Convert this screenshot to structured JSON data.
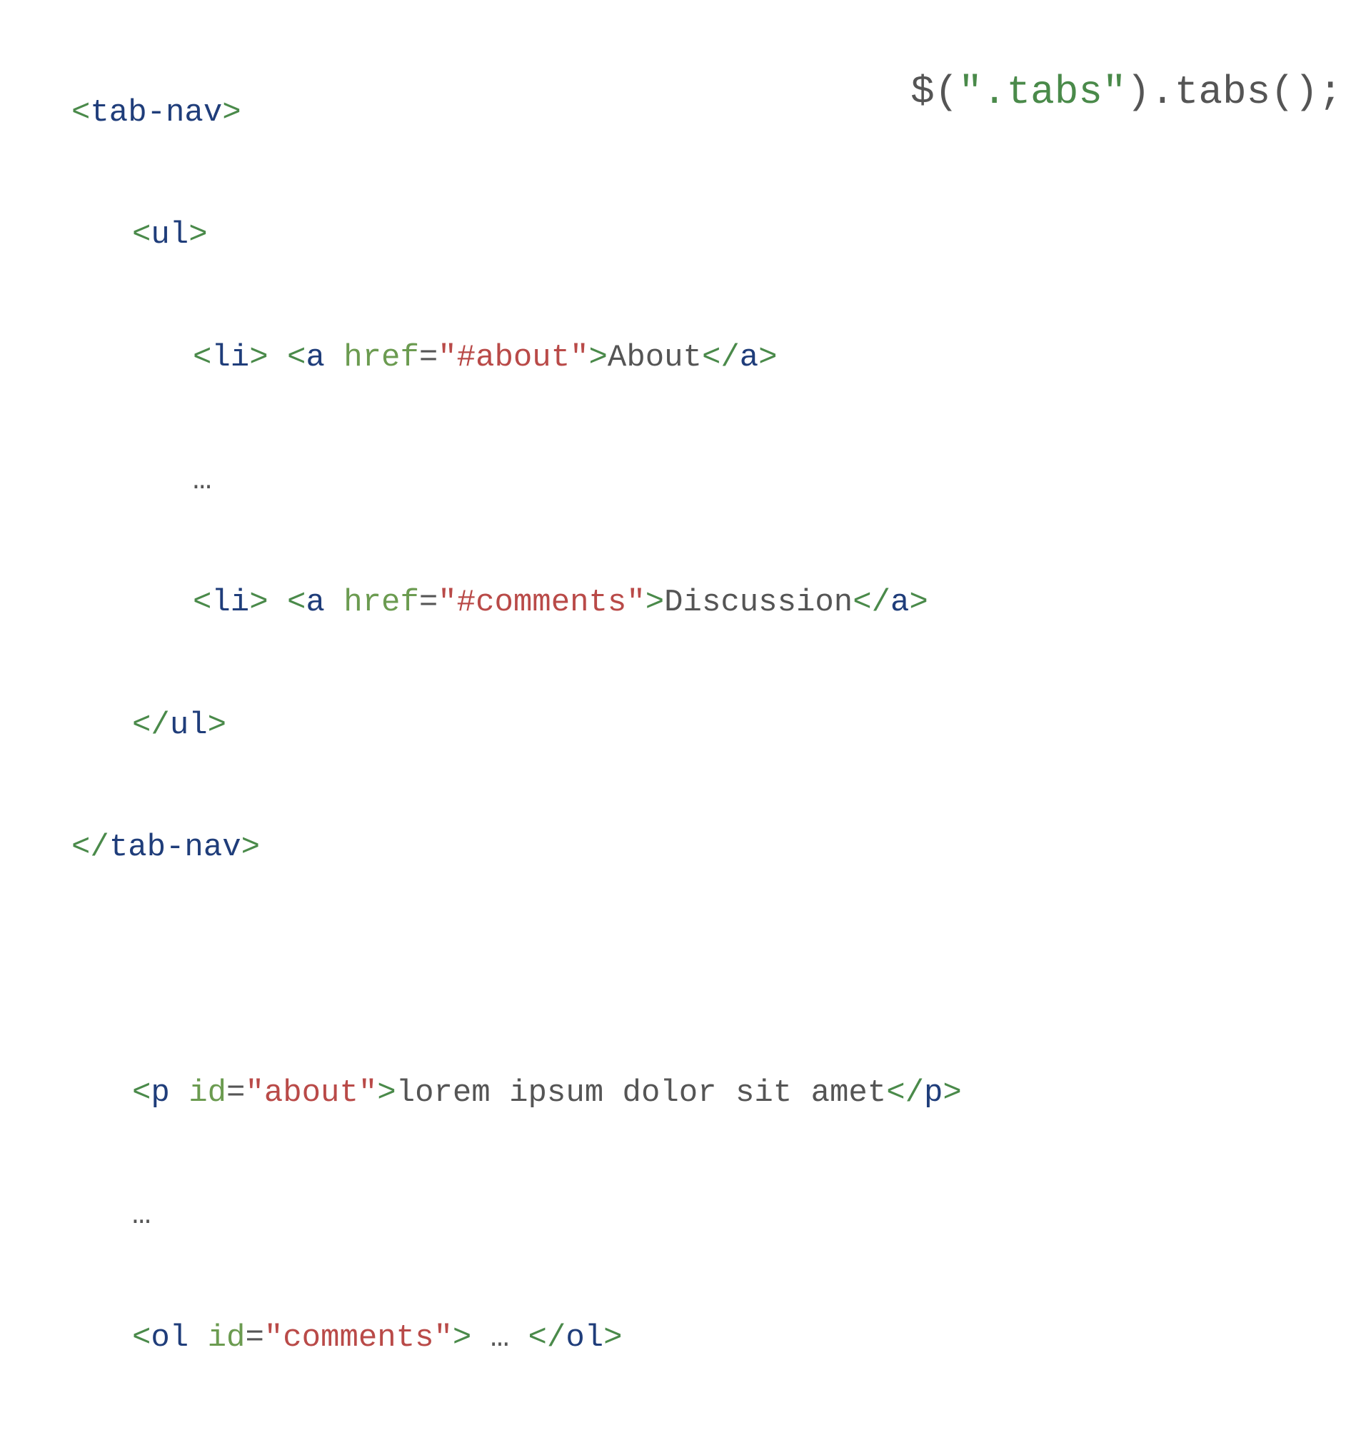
{
  "code": {
    "line1": {
      "open_bracket": "<",
      "tag": "tab-nav",
      "close_bracket": ">"
    },
    "line2": {
      "open_bracket": "<",
      "tag": "ul",
      "close_bracket": ">"
    },
    "line3": {
      "li_open_bracket": "<",
      "li_tag": "li",
      "li_close_bracket": ">",
      "space": " ",
      "a_open_bracket": "<",
      "a_tag": "a",
      "attr_space": " ",
      "attr_name": "href",
      "eq": "=",
      "attr_value": "\"#about\"",
      "a_close_bracket": ">",
      "content": "About",
      "a_end_open": "</",
      "a_end_tag": "a",
      "a_end_close": ">"
    },
    "line4": {
      "ellipsis": "…"
    },
    "line5": {
      "li_open_bracket": "<",
      "li_tag": "li",
      "li_close_bracket": ">",
      "space": " ",
      "a_open_bracket": "<",
      "a_tag": "a",
      "attr_space": " ",
      "attr_name": "href",
      "eq": "=",
      "attr_value": "\"#comments\"",
      "a_close_bracket": ">",
      "content": "Discussion",
      "a_end_open": "</",
      "a_end_tag": "a",
      "a_end_close": ">"
    },
    "line6": {
      "open_bracket": "</",
      "tag": "ul",
      "close_bracket": ">"
    },
    "line7": {
      "open_bracket": "</",
      "tag": "tab-nav",
      "close_bracket": ">"
    },
    "line9": {
      "open_bracket": "<",
      "tag": "p",
      "attr_space": " ",
      "attr_name": "id",
      "eq": "=",
      "attr_value": "\"about\"",
      "close_bracket": ">",
      "content": "lorem ipsum dolor sit amet",
      "end_open": "</",
      "end_tag": "p",
      "end_close": ">"
    },
    "line10": {
      "ellipsis": "…"
    },
    "line11": {
      "open_bracket": "<",
      "tag": "ol",
      "attr_space": " ",
      "attr_name": "id",
      "eq": "=",
      "attr_value": "\"comments\"",
      "close_bracket": ">",
      "content": " … ",
      "end_open": "</",
      "end_tag": "ol",
      "end_close": ">"
    }
  },
  "js": {
    "prefix": "$(",
    "str": "\".tabs\"",
    "suffix": ").tabs();"
  }
}
